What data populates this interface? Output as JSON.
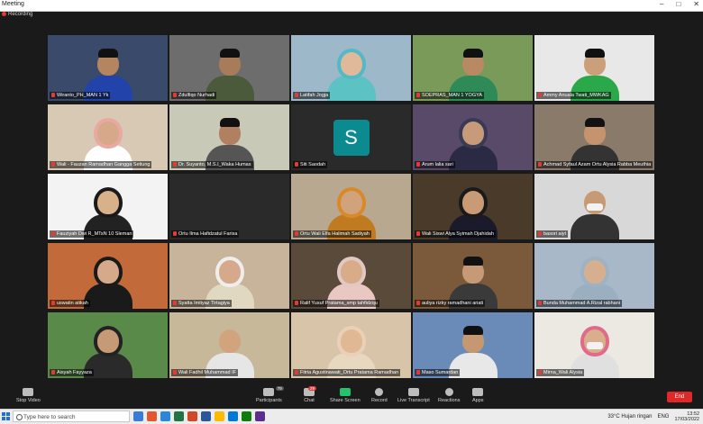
{
  "window": {
    "title": "Meeting",
    "recording_label": "Recording",
    "controls": [
      "–",
      "□",
      "✕"
    ]
  },
  "participants": [
    {
      "name": "Wiranto_PH_MAN 1 Yk",
      "active": true,
      "bg": "#3a4a6a",
      "skin": "#b58560",
      "shirt": "#2244aa",
      "hat": true
    },
    {
      "name": "Zdulfiqo Nurhadi",
      "bg": "#6d6d6d",
      "skin": "#a87c5a",
      "shirt": "#4a5a3a",
      "hat": true
    },
    {
      "name": "Latifah Jogja",
      "bg": "#9db8c8",
      "skin": "#e0b89a",
      "shirt": "#5cc2c4",
      "hijab": "#53b9c6"
    },
    {
      "name": "SOEPRAS_MAN 1 YOGYA",
      "bg": "#7a9a5a",
      "skin": "#b88962",
      "shirt": "#2e8b57",
      "hat": true
    },
    {
      "name": "Ammy Anuala Twati_MWKAG",
      "bg": "#e8e8e8",
      "skin": "#c9a07a",
      "shirt": "#2aa84a",
      "hat": true
    },
    {
      "name": "Wali - Fauzan Ramadhan Gangga Setiung",
      "bg": "#d8c9b4",
      "skin": "#d6a98a",
      "shirt": "#ffffff",
      "hijab": "#e9a9a0"
    },
    {
      "name": "Dr. Suyanto, M.S.I_Waka Humas",
      "bg": "#c9c9b8",
      "skin": "#b08060",
      "shirt": "#555555",
      "hat": true
    },
    {
      "name": "Siti Saodah",
      "initial": "S",
      "bg": "#2a2a2a"
    },
    {
      "name": "Arum lalia sari",
      "bg": "#5a4a6a",
      "skin": "#c79a7a",
      "shirt": "#2a2a44",
      "hijab": "#3a3a55"
    },
    {
      "name": "Achmad Syfaul Azam Ortu Alysia Rabba Meuthia",
      "bg": "#8a7a6a",
      "skin": "#c5946f",
      "shirt": "#333333",
      "hat": true
    },
    {
      "name": "Fauziyah Dwi R_MTsN 10 Sleman",
      "bg": "#f3f3f3",
      "skin": "#d8b08a",
      "shirt": "#222222",
      "hijab": "#1a1a1a"
    },
    {
      "name": "Ortu Ilma Hafidzatul Farisa",
      "bg": "#2a2a2a",
      "empty": true
    },
    {
      "name": "Ortu Wali Elfa Halimah Sadiyah",
      "bg": "#b8a890",
      "skin": "#d1a37c",
      "shirt": "#c07a20",
      "hijab": "#d88a2a"
    },
    {
      "name": "Wali Siswi Alya Syimah Djahidah",
      "bg": "#4a3a2a",
      "skin": "#c99a76",
      "shirt": "#1a1a2a",
      "hijab": "#1a1a1a"
    },
    {
      "name": "basori aiyt",
      "bg": "#d8d8d8",
      "skin": "#c79a76",
      "shirt": "#333333",
      "mask": true
    },
    {
      "name": "uswatin atikah",
      "bg": "#c26a3a",
      "skin": "#d6a98a",
      "shirt": "#1a1a1a",
      "hijab": "#1a1a1a"
    },
    {
      "name": "Syatta Imtiyaz Tirtagiya",
      "bg": "#c8b49a",
      "skin": "#d6a98a",
      "shirt": "#e0d8c0",
      "hijab": "#eee"
    },
    {
      "name": "Ralif Yusuf Pratama_smp tahfidzqu",
      "bg": "#5a4a3a",
      "skin": "#d8ac88",
      "shirt": "#e9c7c2",
      "hijab": "#e0c9c4"
    },
    {
      "name": "auliya rizky ramadhani ariati",
      "bg": "#7a5a3a",
      "skin": "#c69a76",
      "shirt": "#3a3a3a",
      "hat": true
    },
    {
      "name": "Bunda Muhammad A.Rizal rabhani",
      "bg": "#a8b8c8",
      "skin": "#d6b08e",
      "shirt": "#9ab0c0",
      "hijab": "#9db2c4"
    },
    {
      "name": "Aisyah Fayyaza",
      "bg": "#5a8a4a",
      "skin": "#c79a76",
      "shirt": "#2a2a2a",
      "hijab": "#222"
    },
    {
      "name": "Wali Fadhil Muhammad IF",
      "bg": "#c8b89a",
      "skin": "#d2a47e",
      "shirt": "#e6e6e6"
    },
    {
      "name": "Fitria Agustinawati_Ortu Pratama Ramadhan",
      "bg": "#d8c4a8",
      "skin": "#e0b894",
      "shirt": "#e8d8c0",
      "hijab": "#e9d0b8"
    },
    {
      "name": "Maso Sumardan",
      "bg": "#6a8ab8",
      "skin": "#c69872",
      "shirt": "#e8e8e8",
      "hat": true
    },
    {
      "name": "Mirna_Wali Alysia",
      "bg": "#ece8e2",
      "skin": "#d8ae8c",
      "shirt": "#e0e0e0",
      "hijab": "#e06a8a",
      "mask": true
    }
  ],
  "toolbar": {
    "stop_video": "Stop Video",
    "participants": "Participants",
    "participants_count": "79",
    "chat": "Chat",
    "chat_badge": "29",
    "share_screen": "Share Screen",
    "record": "Record",
    "live_transcript": "Live Transcript",
    "reactions": "Reactions",
    "apps": "Apps",
    "end": "End"
  },
  "taskbar": {
    "search_placeholder": "Type here to search",
    "weather": "33°C  Hujan ringan",
    "lang": "ENG",
    "time": "13:52",
    "date": "17/03/2022",
    "app_colors": [
      "#3a7bd5",
      "#e4572e",
      "#2b88d8",
      "#217346",
      "#d24726",
      "#2b579a",
      "#ffb900",
      "#0078d7",
      "#107c10",
      "#5c2d91"
    ]
  }
}
